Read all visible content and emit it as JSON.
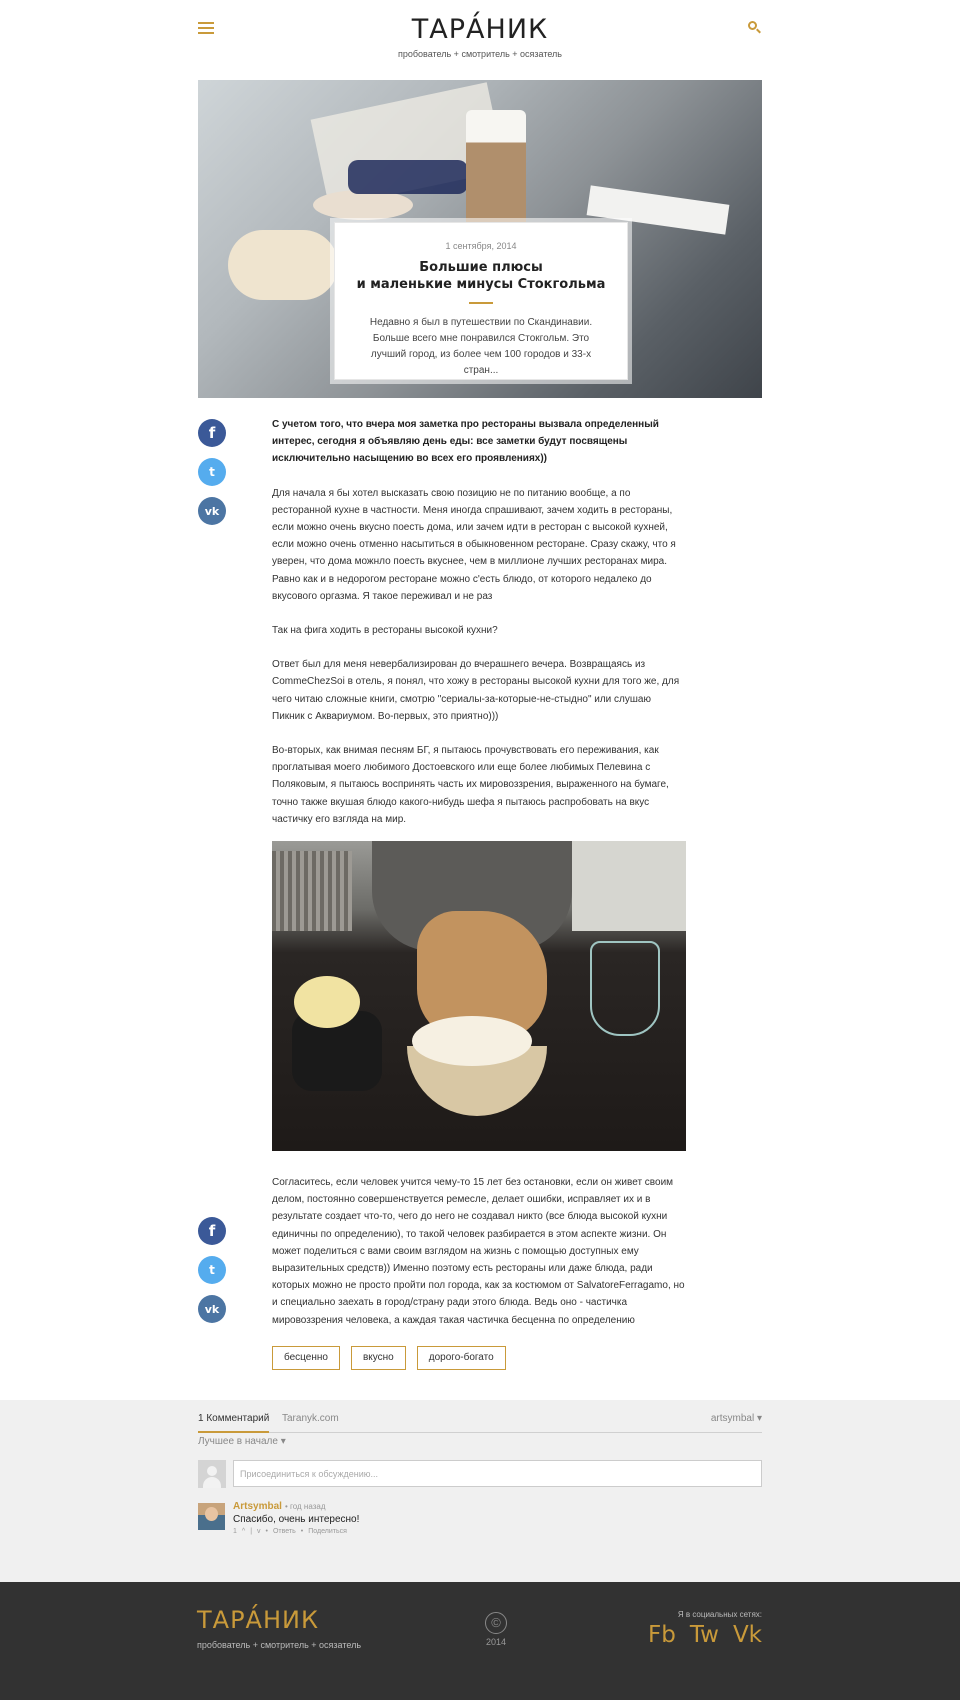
{
  "site": {
    "logo": "ТАРА́НИК",
    "tagline": "пробователь + смотритель + осязатель"
  },
  "icons": {
    "menu": "hamburger-menu-icon",
    "search": "search-icon",
    "accent_color": "#c99a3a"
  },
  "hero": {
    "date": "1 сентября, 2014",
    "title": "Большие плюсы\nи маленькие минусы Стокгольма",
    "excerpt": "Недавно я был в путешествии по Скандинавии. Больше всего мне понравился Стокгольм. Это лучший город, из более чем 100 городов и 33-х стран..."
  },
  "share": {
    "facebook": "f",
    "twitter": "t",
    "vk": "vk",
    "colors": {
      "facebook": "#3b5998",
      "twitter": "#55acee",
      "vk": "#4c75a3"
    }
  },
  "article": {
    "lead": "С учетом того, что вчера моя заметка про рестораны вызвала определенный интерес, сегодня я объявляю день еды: все заметки будут посвящены исключительно насыщению во всех его проявлениях))",
    "p1": "Для начала я бы хотел высказать свою позицию не по питанию вообще, а по ресторанной кухне в частности. Меня иногда спрашивают, зачем ходить в рестораны, если можно очень вкусно поесть дома, или зачем идти в ресторан с высокой кухней, если можно очень отменно насытиться в обыкновенном ресторане. Сразу скажу, что я уверен, что дома можнло поесть вкуснее, чем в миллионе лучших ресторанах мира. Равно как и в недорогом ресторане можно с'есть блюдо, от которого недалеко до вкусового оргазма. Я такое переживал и не раз",
    "p2": "Так на фига ходить в рестораны высокой кухни?",
    "p3": "Ответ был для меня невербализирован до вчерашнего вечера. Возвращаясь из CommeChezSoi в отель, я понял, что хожу в рестораны высокой кухни для того же, для чего читаю сложные книги, смотрю \"сериалы-за-которые-не-стыдно\" или слушаю Пикник с Аквариумом. Во-первых, это приятно)))",
    "p4": "Во-вторых, как внимая песням БГ, я пытаюсь прочувствовать его переживания, как проглатывая моего любимого Достоевского или еще более любимых Пелевина с Поляковым, я пытаюсь воспринять часть их мировоззрения, выраженного на бумаге, точно также вкушая блюдо какого-нибудь шефа я пытаюсь распробовать на вкус частичку его взгляда на мир.",
    "p5": "Согласитесь, если человек учится чему-то 15 лет без остановки, если он живет своим делом, постоянно совершенствуется ремесле, делает ошибки, исправляет их и в результате создает что-то, чего до него не создавал никто (все блюда высокой кухни единичны по определению), то такой человек разбирается в этом аспекте жизни. Он может поделиться с вами своим взглядом на жизнь с помощью доступных ему выразительных средств)) Именно поэтому есть рестораны или даже блюда, ради которых можно не просто пройти пол города, как за костюмом от SalvatoreFerragamo, но и специально заехать в город/страну ради этого блюда. Ведь оно - частичка мировоззрения человека, а каждая такая частичка бесценна по определению"
  },
  "tags": [
    "бесценно",
    "вкусно",
    "дорого-богато"
  ],
  "comments": {
    "count_tab": "1 Комментарий",
    "site_tab": "Taranyk.com",
    "user": "artsymbal ▾",
    "sort": "Лучшее в начале ▾",
    "input_placeholder": "Присоединиться к обсуждению...",
    "items": [
      {
        "author": "Artsymbal",
        "time": "• год назад",
        "text": "Спасибо, очень интересно!",
        "votes": "1",
        "up": "^",
        "sep": "|",
        "down": "v",
        "dot1": "•",
        "reply": "Ответь",
        "dot2": "•",
        "share": "Поделиться"
      }
    ]
  },
  "footer": {
    "logo": "ТАРА́НИК",
    "tagline": "пробователь + смотритель + осязатель",
    "copyright_symbol": "©",
    "year": "2014",
    "social_label": "Я в социальных сетях:",
    "fb": "Fb",
    "tw": "Tw",
    "vk": "Vk"
  }
}
